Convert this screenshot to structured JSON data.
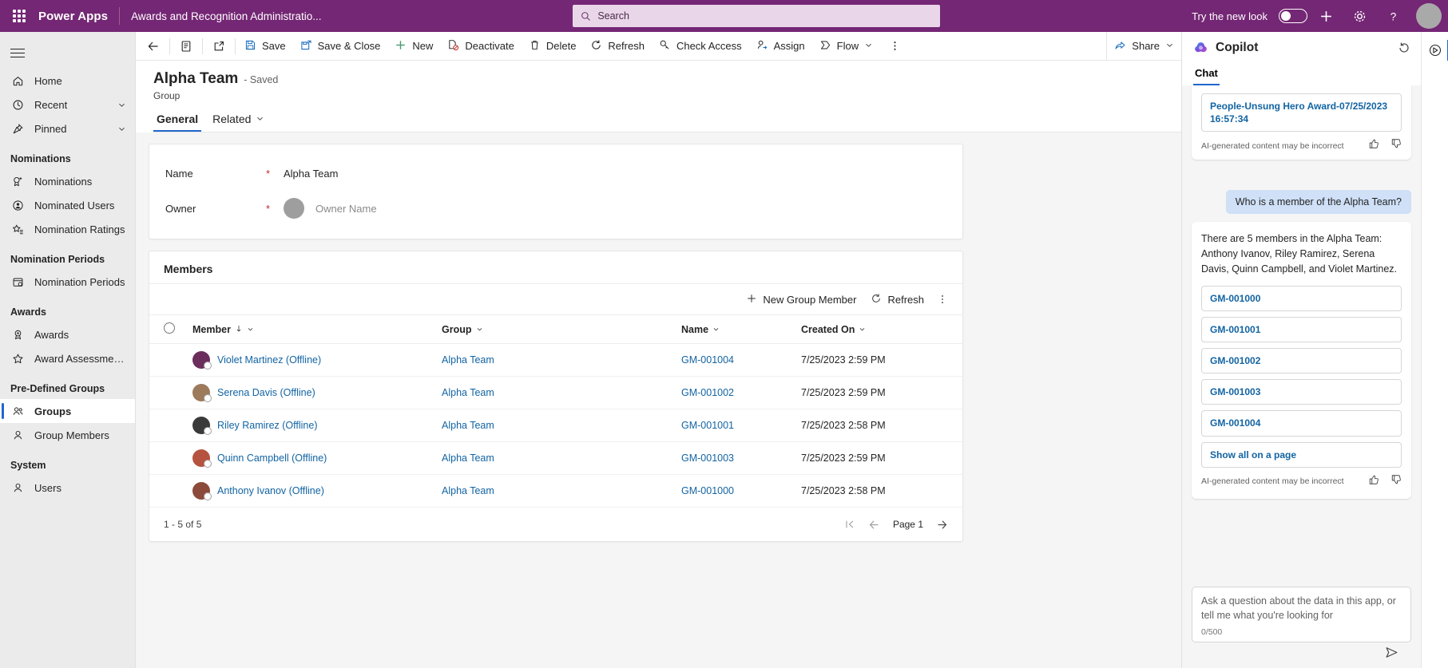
{
  "header": {
    "brand": "Power Apps",
    "app_name": "Awards and Recognition Administratio...",
    "search_placeholder": "Search",
    "try_new_look": "Try the new look",
    "waffle_icon": "app-launcher-icon",
    "search_icon": "search-icon",
    "add_icon": "plus-icon",
    "settings_icon": "gear-icon",
    "help_icon": "question-mark-icon",
    "avatar_icon": "user-avatar",
    "accent_color": "#742774"
  },
  "sidebar": {
    "menu_icon": "hamburger-icon",
    "items": [
      {
        "label": "Home",
        "icon": "home-icon",
        "chevron": false,
        "selected": false
      },
      {
        "label": "Recent",
        "icon": "clock-icon",
        "chevron": true,
        "selected": false
      },
      {
        "label": "Pinned",
        "icon": "pin-icon",
        "chevron": true,
        "selected": false
      }
    ],
    "groups": [
      {
        "title": "Nominations",
        "items": [
          {
            "label": "Nominations",
            "icon": "ribbon-plus-icon",
            "selected": false
          },
          {
            "label": "Nominated Users",
            "icon": "user-badge-icon",
            "selected": false
          },
          {
            "label": "Nomination Ratings",
            "icon": "star-list-icon",
            "selected": false
          }
        ]
      },
      {
        "title": "Nomination Periods",
        "items": [
          {
            "label": "Nomination Periods",
            "icon": "calendar-clock-icon",
            "selected": false
          }
        ]
      },
      {
        "title": "Awards",
        "items": [
          {
            "label": "Awards",
            "icon": "award-medal-icon",
            "selected": false
          },
          {
            "label": "Award Assessment R...",
            "icon": "star-icon",
            "selected": false
          }
        ]
      },
      {
        "title": "Pre-Defined Groups",
        "items": [
          {
            "label": "Groups",
            "icon": "people-icon",
            "selected": true
          },
          {
            "label": "Group Members",
            "icon": "person-icon",
            "selected": false
          }
        ]
      },
      {
        "title": "System",
        "items": [
          {
            "label": "Users",
            "icon": "person-icon",
            "selected": false
          }
        ]
      }
    ]
  },
  "command_bar": {
    "back_icon": "arrow-left-icon",
    "form_icon": "form-selector-icon",
    "popout_icon": "open-in-new-window-icon",
    "buttons": [
      {
        "label": "Save",
        "icon": "save-icon"
      },
      {
        "label": "Save & Close",
        "icon": "save-close-icon"
      },
      {
        "label": "New",
        "icon": "plus-icon"
      },
      {
        "label": "Deactivate",
        "icon": "deactivate-icon"
      },
      {
        "label": "Delete",
        "icon": "trash-icon"
      },
      {
        "label": "Refresh",
        "icon": "refresh-icon"
      },
      {
        "label": "Check Access",
        "icon": "key-icon"
      },
      {
        "label": "Assign",
        "icon": "assign-user-icon"
      },
      {
        "label": "Flow",
        "icon": "flow-icon",
        "chevron": true
      }
    ],
    "overflow_icon": "more-vertical-icon",
    "share_label": "Share",
    "share_icon": "share-icon"
  },
  "record": {
    "title": "Alpha Team",
    "saved_state": "- Saved",
    "entity": "Group",
    "tabs": [
      {
        "label": "General",
        "active": true,
        "chevron": false
      },
      {
        "label": "Related",
        "active": false,
        "chevron": true
      }
    ]
  },
  "form": {
    "fields": [
      {
        "label": "Name",
        "required": true,
        "value": "Alpha Team",
        "is_placeholder": false,
        "has_avatar": false
      },
      {
        "label": "Owner",
        "required": true,
        "value": "Owner Name",
        "is_placeholder": true,
        "has_avatar": true
      }
    ]
  },
  "members_grid": {
    "title": "Members",
    "commands": [
      {
        "label": "New Group Member",
        "icon": "plus-icon"
      },
      {
        "label": "Refresh",
        "icon": "refresh-icon"
      }
    ],
    "overflow_icon": "more-vertical-icon",
    "select_all_icon": "select-all-circle",
    "columns": [
      {
        "label": "Member",
        "sorted": true,
        "sort_dir": "down"
      },
      {
        "label": "Group",
        "sorted": false
      },
      {
        "label": "Name",
        "sorted": false
      },
      {
        "label": "Created On",
        "sorted": false
      }
    ],
    "rows": [
      {
        "member": "Violet Martinez (Offline)",
        "avatar_color": "#6b2d5c",
        "group": "Alpha Team",
        "name": "GM-001004",
        "created_on": "7/25/2023 2:59 PM"
      },
      {
        "member": "Serena Davis (Offline)",
        "avatar_color": "#9c7a5c",
        "group": "Alpha Team",
        "name": "GM-001002",
        "created_on": "7/25/2023 2:59 PM"
      },
      {
        "member": "Riley Ramirez (Offline)",
        "avatar_color": "#3a3a3a",
        "group": "Alpha Team",
        "name": "GM-001001",
        "created_on": "7/25/2023 2:58 PM"
      },
      {
        "member": "Quinn Campbell (Offline)",
        "avatar_color": "#b5533f",
        "group": "Alpha Team",
        "name": "GM-001003",
        "created_on": "7/25/2023 2:59 PM"
      },
      {
        "member": "Anthony Ivanov (Offline)",
        "avatar_color": "#8c4a3a",
        "group": "Alpha Team",
        "name": "GM-001000",
        "created_on": "7/25/2023 2:58 PM"
      }
    ],
    "footer_count": "1 - 5 of 5",
    "page_label": "Page 1",
    "first_page_icon": "first-page-icon",
    "prev_page_icon": "previous-page-icon",
    "next_page_icon": "next-page-icon"
  },
  "copilot": {
    "title": "Copilot",
    "logo_icon": "copilot-logo-icon",
    "refresh_icon": "refresh-history-icon",
    "tabs": [
      {
        "label": "Chat",
        "active": true
      }
    ],
    "previous_answer": {
      "chip_label": "People-Unsung Hero Award-07/25/2023 16:57:34",
      "disclaimer": "AI-generated content may be incorrect",
      "thumbs_up_icon": "thumbs-up-icon",
      "thumbs_down_icon": "thumbs-down-icon"
    },
    "user_message": "Who is a member of the Alpha Team?",
    "answer": {
      "text": "There are 5 members in the Alpha Team: Anthony Ivanov, Riley Ramirez, Serena Davis, Quinn Campbell, and Violet Martinez.",
      "chips": [
        "GM-001000",
        "GM-001001",
        "GM-001002",
        "GM-001003",
        "GM-001004",
        "Show all on a page"
      ],
      "disclaimer": "AI-generated content may be incorrect",
      "thumbs_up_icon": "thumbs-up-icon",
      "thumbs_down_icon": "thumbs-down-icon"
    },
    "input": {
      "placeholder": "Ask a question about the data in this app, or tell me what you're looking for",
      "counter": "0/500",
      "send_icon": "send-icon"
    },
    "rail": {
      "buttons": [
        {
          "icon": "copilot-panel-icon",
          "active": true
        }
      ]
    }
  }
}
